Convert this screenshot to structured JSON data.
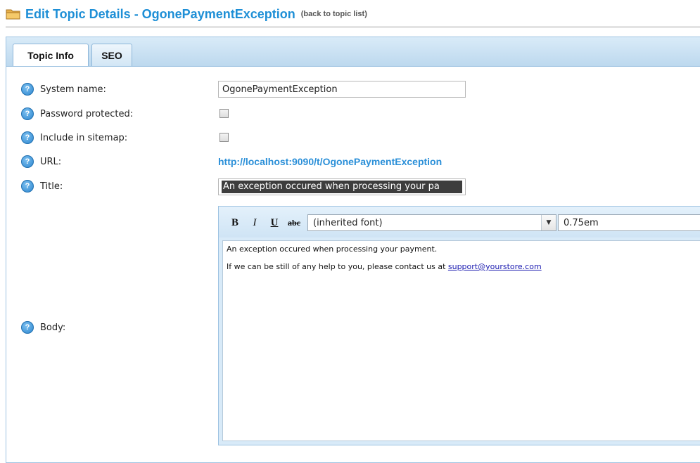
{
  "header": {
    "title": "Edit Topic Details - OgonePaymentException",
    "back_link": "(back to topic list)"
  },
  "tabs": [
    {
      "label": "Topic Info",
      "active": true
    },
    {
      "label": "SEO",
      "active": false
    }
  ],
  "fields": {
    "system_name": {
      "label": "System name:",
      "value": "OgonePaymentException"
    },
    "password_protected": {
      "label": "Password protected:",
      "checked": false
    },
    "include_in_sitemap": {
      "label": "Include in sitemap:",
      "checked": false
    },
    "url": {
      "label": "URL:",
      "value": "http://localhost:9090/t/OgonePaymentException"
    },
    "title": {
      "label": "Title:",
      "value": "An exception occured when processing your pa"
    },
    "body": {
      "label": "Body:"
    }
  },
  "editor": {
    "toolbar": {
      "bold": "B",
      "italic": "I",
      "underline": "U",
      "strike": "abc",
      "font_family": "(inherited font)",
      "font_size": "0.75em"
    },
    "content": {
      "line1": "An exception occured when processing your payment.",
      "line2_text": "If we can be still of any help to you, please contact us at ",
      "line2_link": "support@yourstore.com"
    }
  },
  "icons": {
    "header": "folder-icon",
    "help": "help-icon",
    "dropdown": "chevron-down-icon"
  },
  "colors": {
    "accent": "#1e8fd6",
    "link": "#2a8fd8",
    "tab_bar": "#cfe4f5"
  }
}
